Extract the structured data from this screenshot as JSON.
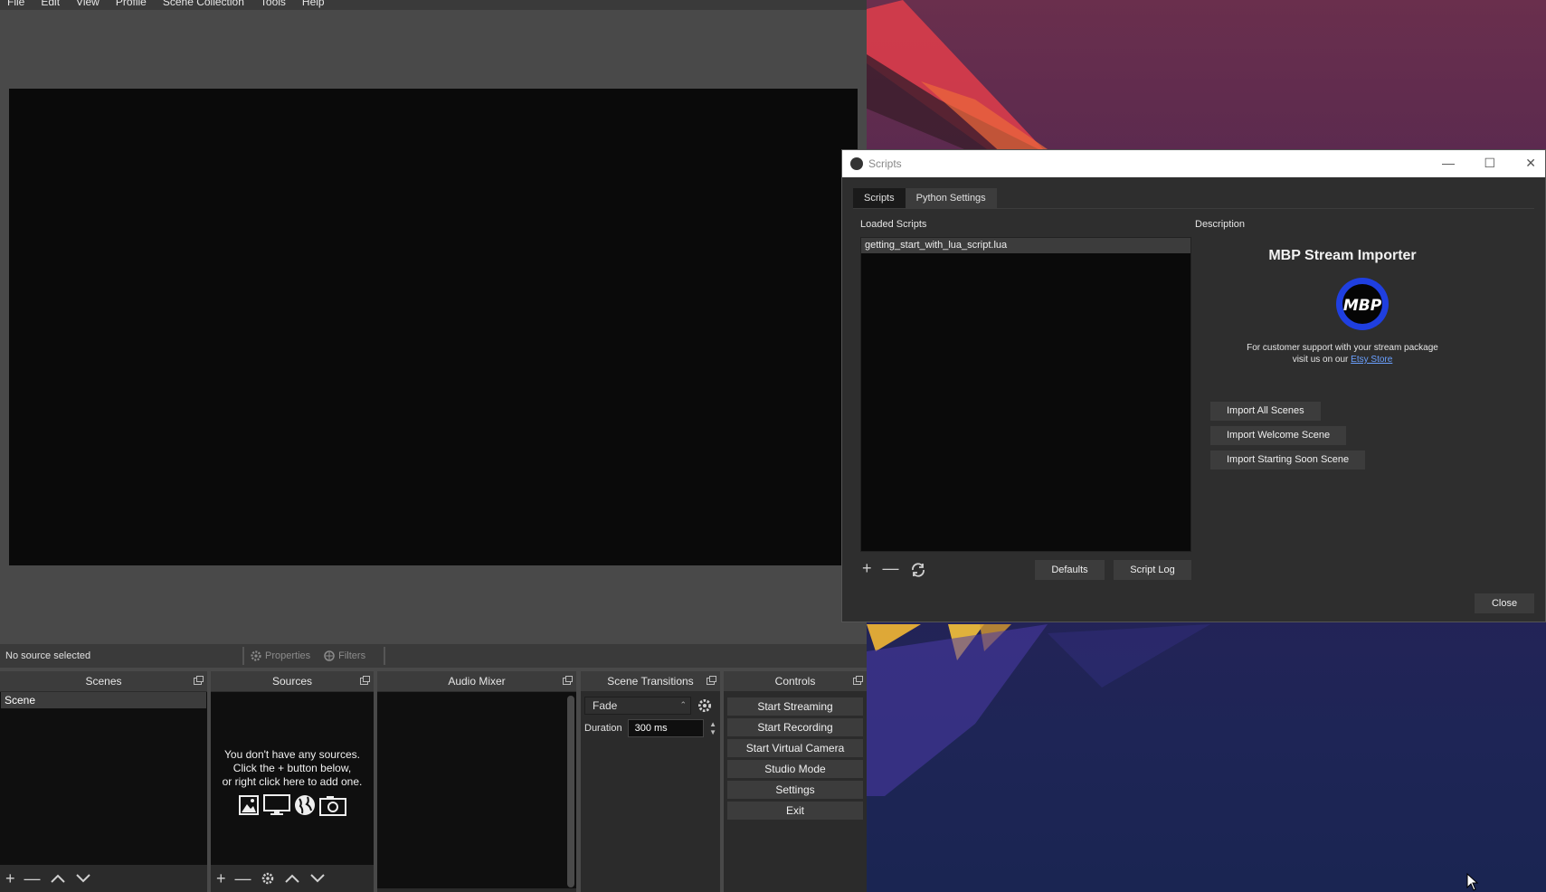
{
  "menubar": [
    "File",
    "Edit",
    "View",
    "Profile",
    "Scene Collection",
    "Tools",
    "Help"
  ],
  "source_bar": {
    "no_source": "No source selected",
    "properties": "Properties",
    "filters": "Filters"
  },
  "docks": {
    "scenes": {
      "title": "Scenes",
      "items": [
        "Scene"
      ]
    },
    "sources": {
      "title": "Sources",
      "empty_line1": "You don't have any sources.",
      "empty_line2": "Click the + button below,",
      "empty_line3": "or right click here to add one."
    },
    "audio_mixer": {
      "title": "Audio Mixer"
    },
    "scene_transitions": {
      "title": "Scene Transitions",
      "transition": "Fade",
      "duration_label": "Duration",
      "duration_value": "300 ms"
    },
    "controls": {
      "title": "Controls",
      "buttons": [
        "Start Streaming",
        "Start Recording",
        "Start Virtual Camera",
        "Studio Mode",
        "Settings",
        "Exit"
      ]
    }
  },
  "dialog": {
    "title": "Scripts",
    "tabs": [
      "Scripts",
      "Python Settings"
    ],
    "loaded_label": "Loaded Scripts",
    "description_label": "Description",
    "scripts": [
      "getting_start_with_lua_script.lua"
    ],
    "defaults": "Defaults",
    "script_log": "Script Log",
    "close": "Close",
    "desc": {
      "title": "MBP Stream Importer",
      "logo_text": "MBP",
      "support_line1": "For customer support with your stream package",
      "support_line2": "visit us on our",
      "support_link": "Etsy Store",
      "buttons": [
        "Import All Scenes",
        "Import Welcome Scene",
        "Import Starting Soon Scene"
      ]
    }
  },
  "colors": {
    "obs_bg": "#494949",
    "panel_bg": "#2b2b2b",
    "link": "#6aa0ff",
    "logo_blue": "#1f3fe0"
  }
}
